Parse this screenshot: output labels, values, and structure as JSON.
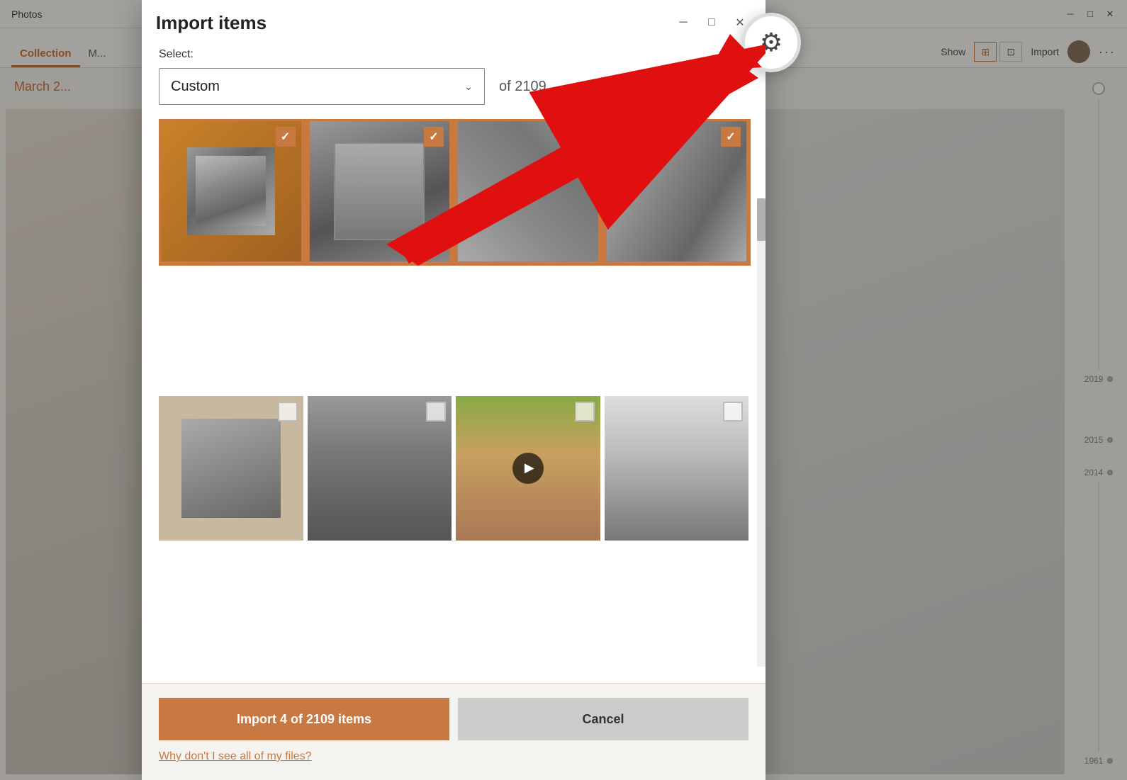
{
  "app": {
    "title": "Photos",
    "titlebar_controls": [
      "─",
      "□",
      "✕"
    ]
  },
  "nav": {
    "tabs": [
      "Collection",
      "M..."
    ],
    "active_tab": "Collection",
    "right_actions": [
      "Import",
      "···"
    ],
    "show_label": "Show"
  },
  "bg_section": {
    "date_label": "March 2..."
  },
  "timeline": {
    "years": [
      "2019",
      "2015",
      "2014",
      "1961"
    ]
  },
  "dialog": {
    "title": "Import items",
    "select_label": "Select:",
    "dropdown_value": "Custom",
    "item_count": "of 2109",
    "settings_tooltip": "Settings"
  },
  "photos": {
    "row1": [
      {
        "selected": true,
        "type": "wooden",
        "bw_class": "photo-bw-1"
      },
      {
        "selected": true,
        "type": "wooden",
        "bw_class": "photo-bw-2"
      },
      {
        "selected": true,
        "type": "wooden",
        "bw_class": "photo-bw-3"
      },
      {
        "selected": true,
        "type": "wooden",
        "bw_class": "photo-bw-4"
      }
    ],
    "row2": [
      {
        "selected": false,
        "type": "plain",
        "bw_class": "photo-bw-1"
      },
      {
        "selected": false,
        "type": "outdoor",
        "bw_class": ""
      },
      {
        "selected": false,
        "type": "color",
        "has_play": true,
        "bw_class": ""
      },
      {
        "selected": false,
        "type": "building",
        "bw_class": ""
      }
    ]
  },
  "footer": {
    "import_btn": "Import 4 of 2109 items",
    "cancel_btn": "Cancel",
    "help_link": "Why don't I see all of my files?"
  }
}
